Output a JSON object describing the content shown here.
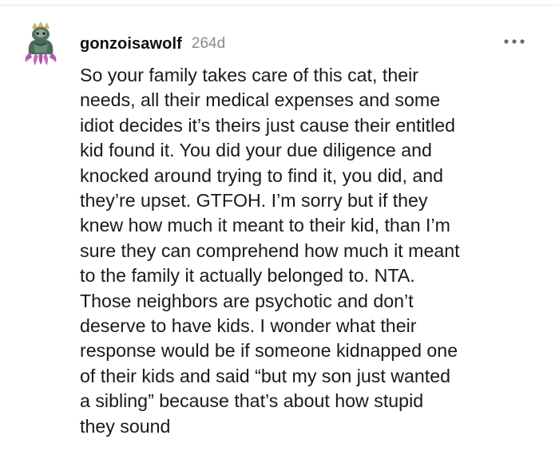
{
  "comment": {
    "username": "gonzoisawolf",
    "timestamp": "264d",
    "avatar_icon": "wolf-avatar-icon",
    "more_icon": "more-options-icon",
    "body": "So your family takes care of this cat, their\nneeds, all their medical expenses and some\nidiot decides it’s theirs just cause their entitled\nkid found it. You did your due diligence and\nknocked around trying to find it, you did, and\nthey’re upset. GTFOH. I’m sorry but if they\nknew how much it meant to their kid, than I’m\nsure they can comprehend how much it meant\nto the family it actually belonged to. NTA.\nThose neighbors are psychotic and don’t\ndeserve to have kids. I wonder what their\nresponse would be if someone kidnapped one\nof their kids and said “but my son just wanted\na sibling” because that’s about how stupid\nthey sound"
  },
  "colors": {
    "username": "#111111",
    "timestamp": "#8a8a8a",
    "body_text": "#1a1a1a",
    "avatar_body": "#4a6a5a",
    "avatar_tentacles": "#b25aa5"
  }
}
